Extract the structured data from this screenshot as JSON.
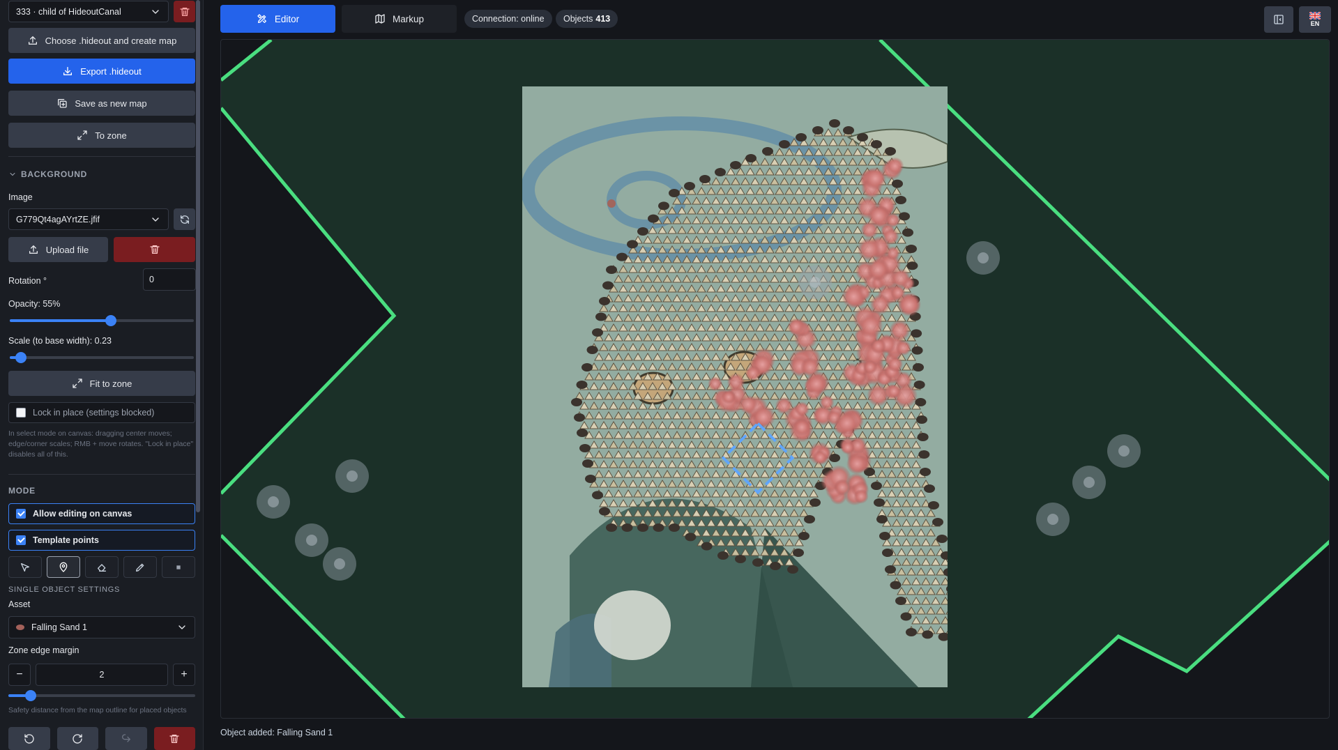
{
  "sidebar": {
    "map_select": "333 · child of HideoutCanal",
    "choose_label": "Choose .hideout and create map",
    "export_label": "Export .hideout",
    "save_new_label": "Save as new map",
    "to_zone_label": "To zone",
    "background": {
      "title": "BACKGROUND",
      "image_label": "Image",
      "image_value": "G779Qt4agAYrtZE.jfif",
      "upload_label": "Upload file",
      "rotation_label": "Rotation °",
      "rotation_value": "0",
      "opacity_label": "Opacity: 55%",
      "opacity_fraction": 0.55,
      "scale_label": "Scale (to base width): 0.23",
      "scale_fraction": 0.06,
      "fit_label": "Fit to zone",
      "lock_label": "Lock in place (settings blocked)",
      "hint": "In select mode on canvas: dragging center moves; edge/corner scales; RMB + move rotates. \"Lock in place\" disables all of this."
    },
    "mode": {
      "title": "MODE",
      "allow_edit_label": "Allow editing on canvas",
      "template_points_label": "Template points"
    },
    "single": {
      "title": "SINGLE OBJECT SETTINGS",
      "asset_label": "Asset",
      "asset_value": "Falling Sand 1",
      "margin_label": "Zone edge margin",
      "margin_value": "2",
      "margin_fraction": 0.12,
      "margin_hint": "Safety distance from the map outline for placed objects"
    }
  },
  "topbar": {
    "editor_tab": "Editor",
    "markup_tab": "Markup",
    "connection": "Connection: online",
    "objects_label": "Objects",
    "objects_count": "413",
    "lang": "EN"
  },
  "status_text": "Object added: Falling Sand 1",
  "colors": {
    "accent": "#2463eb",
    "zone_fill": "#1b3028",
    "zone_outline": "#4ade80",
    "danger": "#7a1d20"
  }
}
